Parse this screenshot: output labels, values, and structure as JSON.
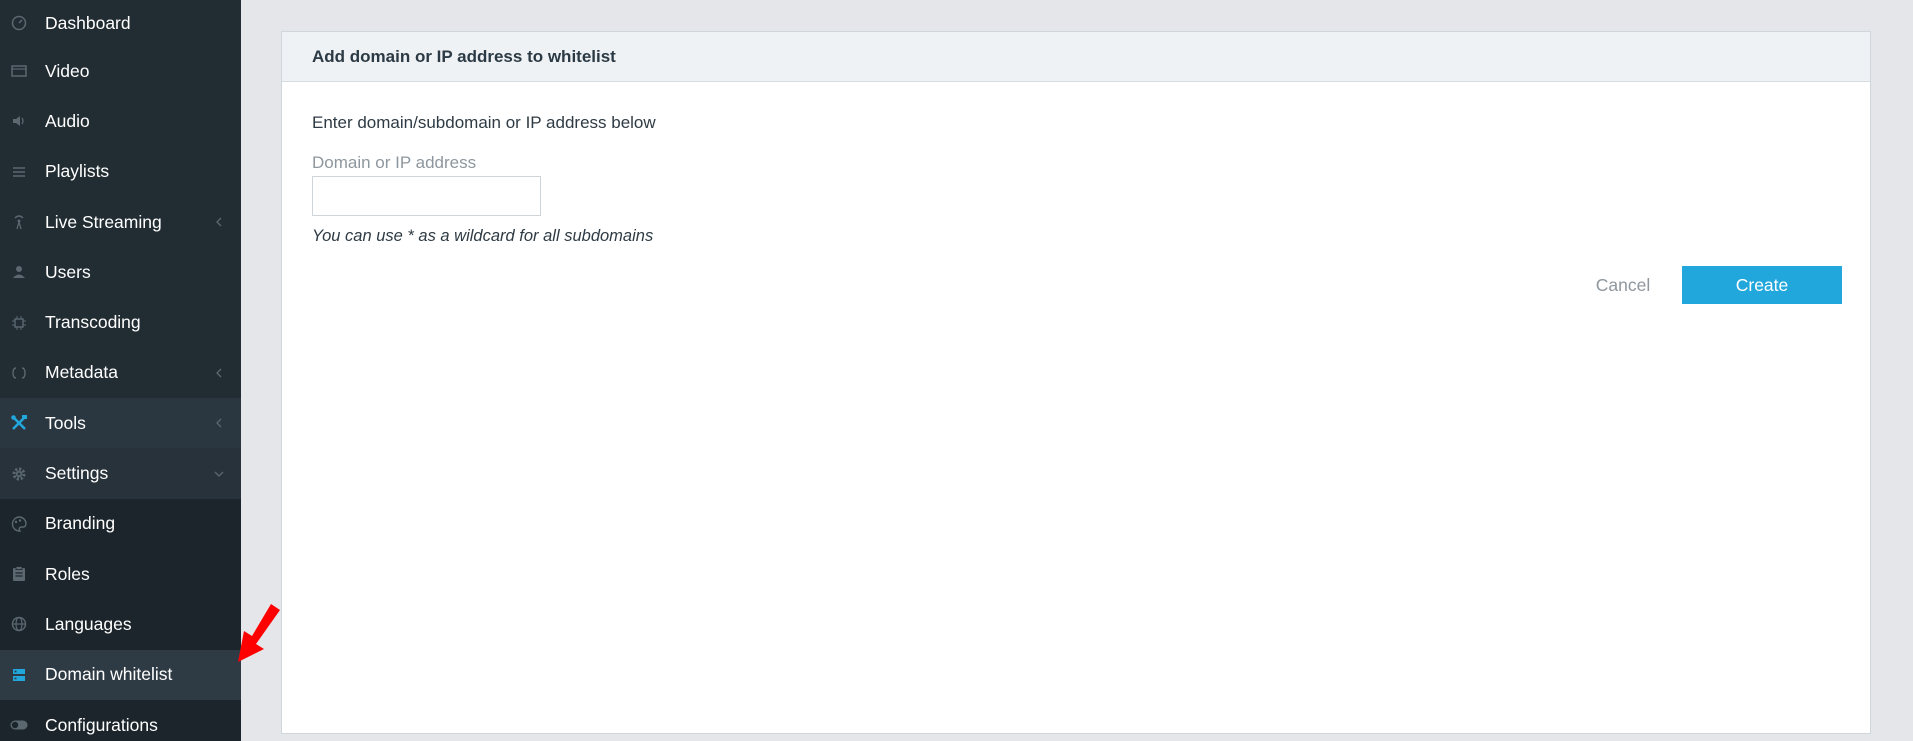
{
  "sidebar": {
    "items": [
      {
        "label": "Dashboard",
        "icon": "dashboard-icon"
      },
      {
        "label": "Video",
        "icon": "video-icon"
      },
      {
        "label": "Audio",
        "icon": "audio-icon"
      },
      {
        "label": "Playlists",
        "icon": "playlist-icon"
      },
      {
        "label": "Live Streaming",
        "icon": "broadcast-icon"
      },
      {
        "label": "Users",
        "icon": "user-icon"
      },
      {
        "label": "Transcoding",
        "icon": "chip-icon"
      },
      {
        "label": "Metadata",
        "icon": "brackets-icon"
      },
      {
        "label": "Tools",
        "icon": "tools-icon"
      },
      {
        "label": "Settings",
        "icon": "gear-icon"
      },
      {
        "label": "Branding",
        "icon": "palette-icon"
      },
      {
        "label": "Roles",
        "icon": "clipboard-icon"
      },
      {
        "label": "Languages",
        "icon": "globe-icon"
      },
      {
        "label": "Domain whitelist",
        "icon": "server-list-icon"
      },
      {
        "label": "Configurations",
        "icon": "toggle-icon"
      }
    ],
    "active_item": "Domain whitelist"
  },
  "panel": {
    "title": "Add domain or IP address to whitelist",
    "instruction": "Enter domain/subdomain or IP address below",
    "field_label": "Domain or IP address",
    "field_value": "",
    "hint": "You can use * as a wildcard for all subdomains",
    "cancel_label": "Cancel",
    "create_label": "Create"
  },
  "colors": {
    "sidebar_bg": "#222c33",
    "accent": "#21a7dc",
    "annotation_arrow": "#ff0000",
    "page_bg": "#e4e6e9"
  }
}
